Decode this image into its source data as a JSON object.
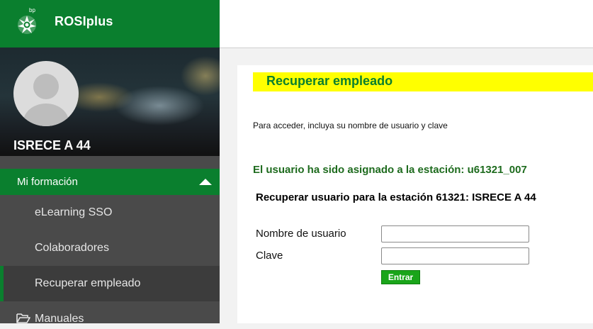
{
  "app": {
    "logo_text": "bp",
    "title": "ROSIplus"
  },
  "profile": {
    "name": "ISRECE A 44"
  },
  "sidebar": {
    "section": {
      "label": "Mi formación",
      "expanded": true
    },
    "items": [
      {
        "label": "eLearning SSO",
        "active": false
      },
      {
        "label": "Colaboradores",
        "active": false
      },
      {
        "label": "Recuperar empleado",
        "active": true
      }
    ],
    "folder": {
      "label": "Manuales"
    }
  },
  "main": {
    "page_title": "Recuperar empleado",
    "instruction": "Para acceder, incluya su nombre de usuario y clave",
    "assigned_message": "El usuario ha sido asignado a la estación: u61321_007",
    "recover_heading": "Recuperar usuario para la estación 61321: ISRECE A 44",
    "form": {
      "username_label": "Nombre de usuario",
      "username_value": "",
      "password_label": "Clave",
      "password_value": "",
      "submit_label": "Entrar"
    }
  },
  "colors": {
    "brand_green": "#0a7f2e",
    "title_highlight": "#ffff00",
    "submit_green": "#1aa51a",
    "sidebar_bg": "#4a4a4a"
  }
}
